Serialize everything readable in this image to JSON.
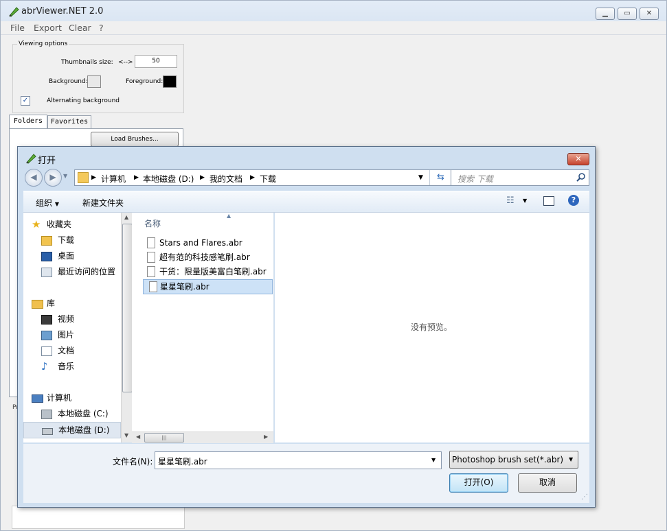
{
  "app": {
    "title": "abrViewer.NET 2.0",
    "menu": [
      "File",
      "Export",
      "Clear",
      "?"
    ],
    "viewing_options": {
      "legend": "Viewing options",
      "thumb_label": "Thumbnails size:",
      "thumb_arrows": "<-->",
      "thumb_value": "50",
      "background_label": "Background:",
      "foreground_label": "Foreground:",
      "alternating_label": "Alternating background",
      "background_color": "#e8e8e8",
      "foreground_color": "#000000"
    },
    "tabs": [
      "Folders",
      "Favorites"
    ],
    "load_button": "Load Brushes...",
    "partial_label": "Pr"
  },
  "dialog": {
    "title": "打开",
    "breadcrumb": [
      "计算机",
      "本地磁盘 (D:)",
      "我的文档",
      "下载"
    ],
    "search_placeholder": "搜索 下载",
    "toolbar": {
      "organize": "组织",
      "new_folder": "新建文件夹"
    },
    "nav": {
      "favorites": {
        "label": "收藏夹",
        "items": [
          "下载",
          "桌面",
          "最近访问的位置"
        ]
      },
      "library": {
        "label": "库",
        "items": [
          "视频",
          "图片",
          "文档",
          "音乐"
        ]
      },
      "computer": {
        "label": "计算机",
        "items": [
          "本地磁盘 (C:)",
          "本地磁盘 (D:)"
        ]
      }
    },
    "column_header": "名称",
    "files": [
      "Stars and Flares.abr",
      "超有范的科技感笔刷.abr",
      "干货：限量版美富白笔刷.abr",
      "星星笔刷.abr"
    ],
    "selected_file_index": 3,
    "preview_text": "没有预览。",
    "filename_label": "文件名(N):",
    "filename_value": "星星笔刷.abr",
    "filetype": "Photoshop brush set(*.abr)",
    "open_button": "打开(O)",
    "cancel_button": "取消"
  }
}
